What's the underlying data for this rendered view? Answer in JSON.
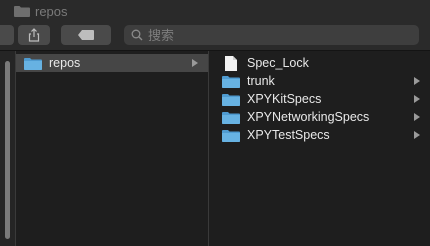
{
  "window": {
    "title": "repos"
  },
  "toolbar": {
    "share_icon": "share-icon",
    "tag_icon": "tag-icon",
    "search": {
      "placeholder": "搜索"
    }
  },
  "columns": {
    "col1": {
      "items": [
        {
          "label": "repos",
          "kind": "folder",
          "selected": true
        }
      ]
    },
    "col2": {
      "items": [
        {
          "label": "Spec_Lock",
          "kind": "file"
        },
        {
          "label": "trunk",
          "kind": "folder"
        },
        {
          "label": "XPYKitSpecs",
          "kind": "folder"
        },
        {
          "label": "XPYNetworkingSpecs",
          "kind": "folder"
        },
        {
          "label": "XPYTestSpecs",
          "kind": "folder"
        }
      ]
    }
  },
  "colors": {
    "folder": "#5aa8d8",
    "background": "#1e1e1e",
    "selection": "#464646"
  }
}
